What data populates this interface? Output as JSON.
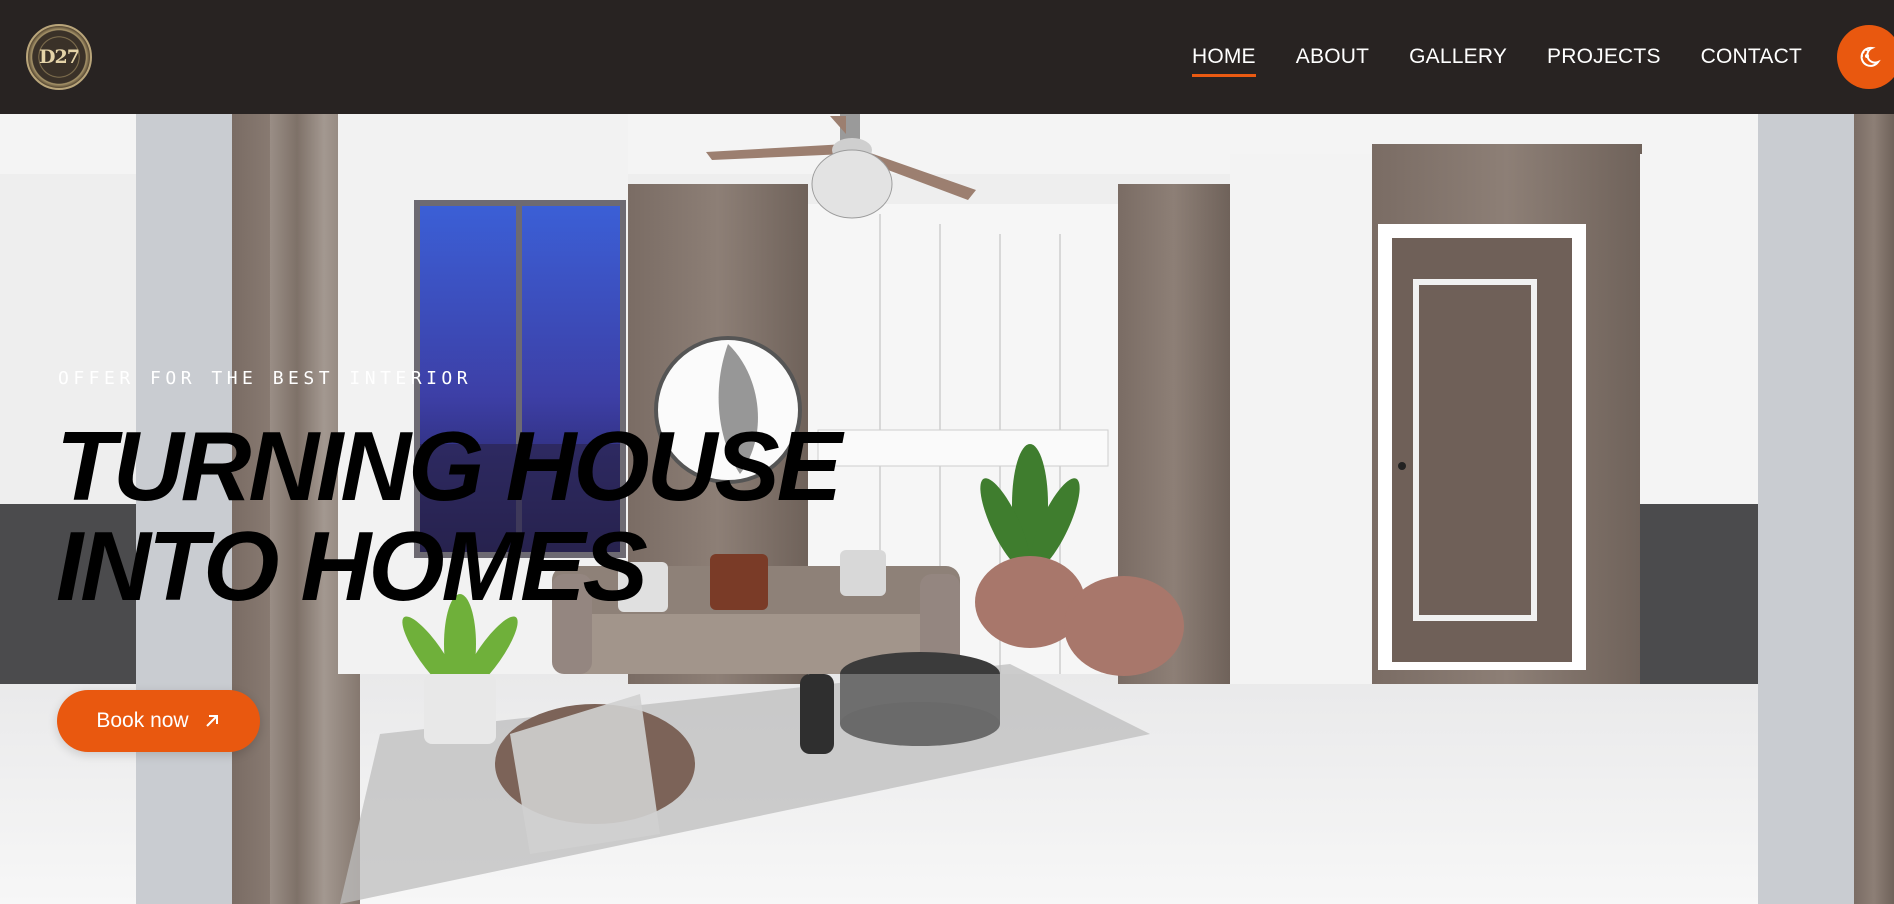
{
  "header": {
    "logo_text": "D27",
    "nav": [
      {
        "label": "HOME",
        "active": true
      },
      {
        "label": "ABOUT",
        "active": false
      },
      {
        "label": "GALLERY",
        "active": false
      },
      {
        "label": "PROJECTS",
        "active": false
      },
      {
        "label": "CONTACT",
        "active": false
      }
    ],
    "theme_toggle_icon": "moon-sun-icon"
  },
  "hero": {
    "tagline": "OFFER FOR THE BEST INTERIOR",
    "headline_line1": "TURNING HOUSE",
    "headline_line2": "INTO HOMES",
    "cta_label": "Book now",
    "cta_icon": "arrow-up-right-icon"
  },
  "colors": {
    "header_bg": "#282322",
    "accent": "#e9580f",
    "nav_text": "#ffffff",
    "headline": "#000000"
  }
}
